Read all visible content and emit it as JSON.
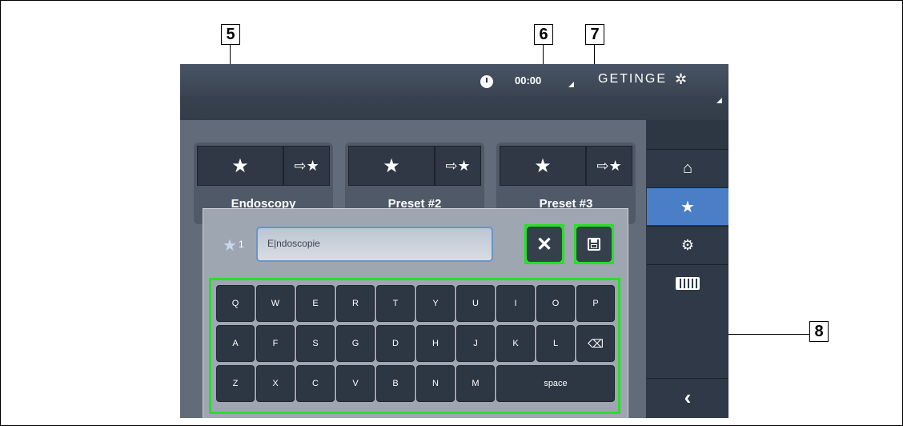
{
  "callouts": {
    "c5": "5",
    "c6": "6",
    "c7": "7",
    "c8": "8"
  },
  "header": {
    "time": "00:00",
    "brand": "GETINGE",
    "brand_mark": "✲"
  },
  "presets": [
    {
      "label": "Endoscopy",
      "load_icon": "star-icon",
      "save_icon": "save-to-preset-icon"
    },
    {
      "label": "Preset #2",
      "load_icon": "star-icon",
      "save_icon": "save-to-preset-icon"
    },
    {
      "label": "Preset #3",
      "load_icon": "star-icon",
      "save_icon": "save-to-preset-icon"
    }
  ],
  "sidebar": {
    "items": [
      "home-icon",
      "star-icon",
      "settings-icon",
      "battery-icon",
      "back-chevron-icon"
    ],
    "active": "star-icon"
  },
  "dialog": {
    "preset_number": "1",
    "name_value": "E|ndoscopie",
    "cancel_icon": "close-icon",
    "save_icon": "floppy-disk-icon"
  },
  "keyboard": {
    "row1": [
      "Q",
      "W",
      "E",
      "R",
      "T",
      "Y",
      "U",
      "I",
      "O",
      "P"
    ],
    "row2": [
      "A",
      "F",
      "S",
      "G",
      "D",
      "H",
      "J",
      "K",
      "L"
    ],
    "row3": [
      "Z",
      "X",
      "C",
      "V",
      "B",
      "N",
      "M"
    ],
    "space": "space",
    "backspace_icon": "backspace-icon"
  },
  "colors": {
    "highlight": "#25e125",
    "active_tab": "#4a7fc8",
    "panel_dark": "#2d3643"
  }
}
